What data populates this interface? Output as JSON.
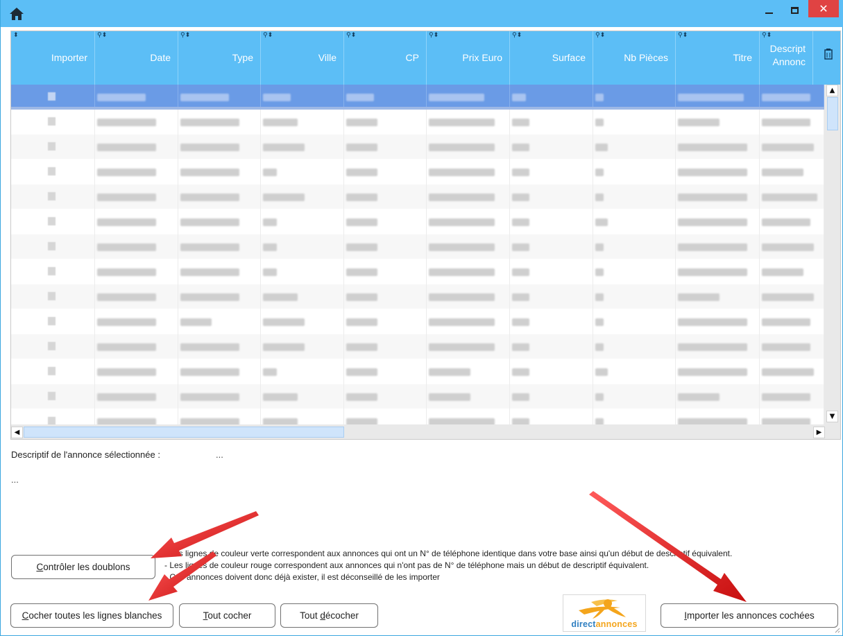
{
  "window": {
    "icon": "home-icon",
    "controls": {
      "minimize_icon": "minimize-icon",
      "maximize_icon": "maximize-icon",
      "close_label": "✕"
    }
  },
  "grid": {
    "columns": [
      {
        "label": "Importer",
        "icon": "sort-icon",
        "filter": false
      },
      {
        "label": "Date",
        "icon": "filter-sort-icon",
        "filter": true
      },
      {
        "label": "Type",
        "icon": "filter-sort-icon",
        "filter": true
      },
      {
        "label": "Ville",
        "icon": "filter-sort-icon",
        "filter": true
      },
      {
        "label": "CP",
        "icon": "filter-sort-icon",
        "filter": true
      },
      {
        "label": "Prix Euro",
        "icon": "filter-sort-icon",
        "filter": true
      },
      {
        "label": "Surface",
        "icon": "filter-sort-icon",
        "filter": true
      },
      {
        "label": "Nb Pièces",
        "icon": "filter-sort-icon",
        "filter": true
      },
      {
        "label": "Titre",
        "icon": "filter-sort-icon",
        "filter": true
      },
      {
        "label_line1": "Descript",
        "label_line2": "Annonc",
        "icon": "filter-sort-icon",
        "filter": true
      }
    ],
    "row_count": 14,
    "selected_row": 0,
    "cell_contents": "redacted",
    "column_picker_icon": "column-picker-icon"
  },
  "description": {
    "label": "Descriptif de l'annonce sélectionnée :",
    "value": "...",
    "text": "..."
  },
  "legend": {
    "lines": [
      "- Les lignes de couleur verte correspondent aux annonces qui ont un N° de téléphone identique dans votre base ainsi qu'un début de descriptif équivalent.",
      "- Les lignes de couleur rouge correspondent aux annonces qui n'ont pas de N° de téléphone mais un début de descriptif équivalent.",
      "- Ces annonces doivent donc déjà exister, il est déconseillé de les importer"
    ]
  },
  "buttons": {
    "controler_doublons": "Contrôler les doublons",
    "cocher_blanches": "Cocher toutes les lignes blanches",
    "tout_cocher": "Tout cocher",
    "tout_decocher": "Tout décocher",
    "importer": "Importer les annonces cochées"
  },
  "logo": {
    "text_part1": "direct",
    "text_part2": "annonces",
    "color_primary": "#2f7fc1",
    "color_accent": "#f4a51c"
  },
  "colors": {
    "header": "#5cbef6",
    "selected_row": "#6a9be6",
    "close_button": "#e04343",
    "arrow": "#e02020"
  }
}
